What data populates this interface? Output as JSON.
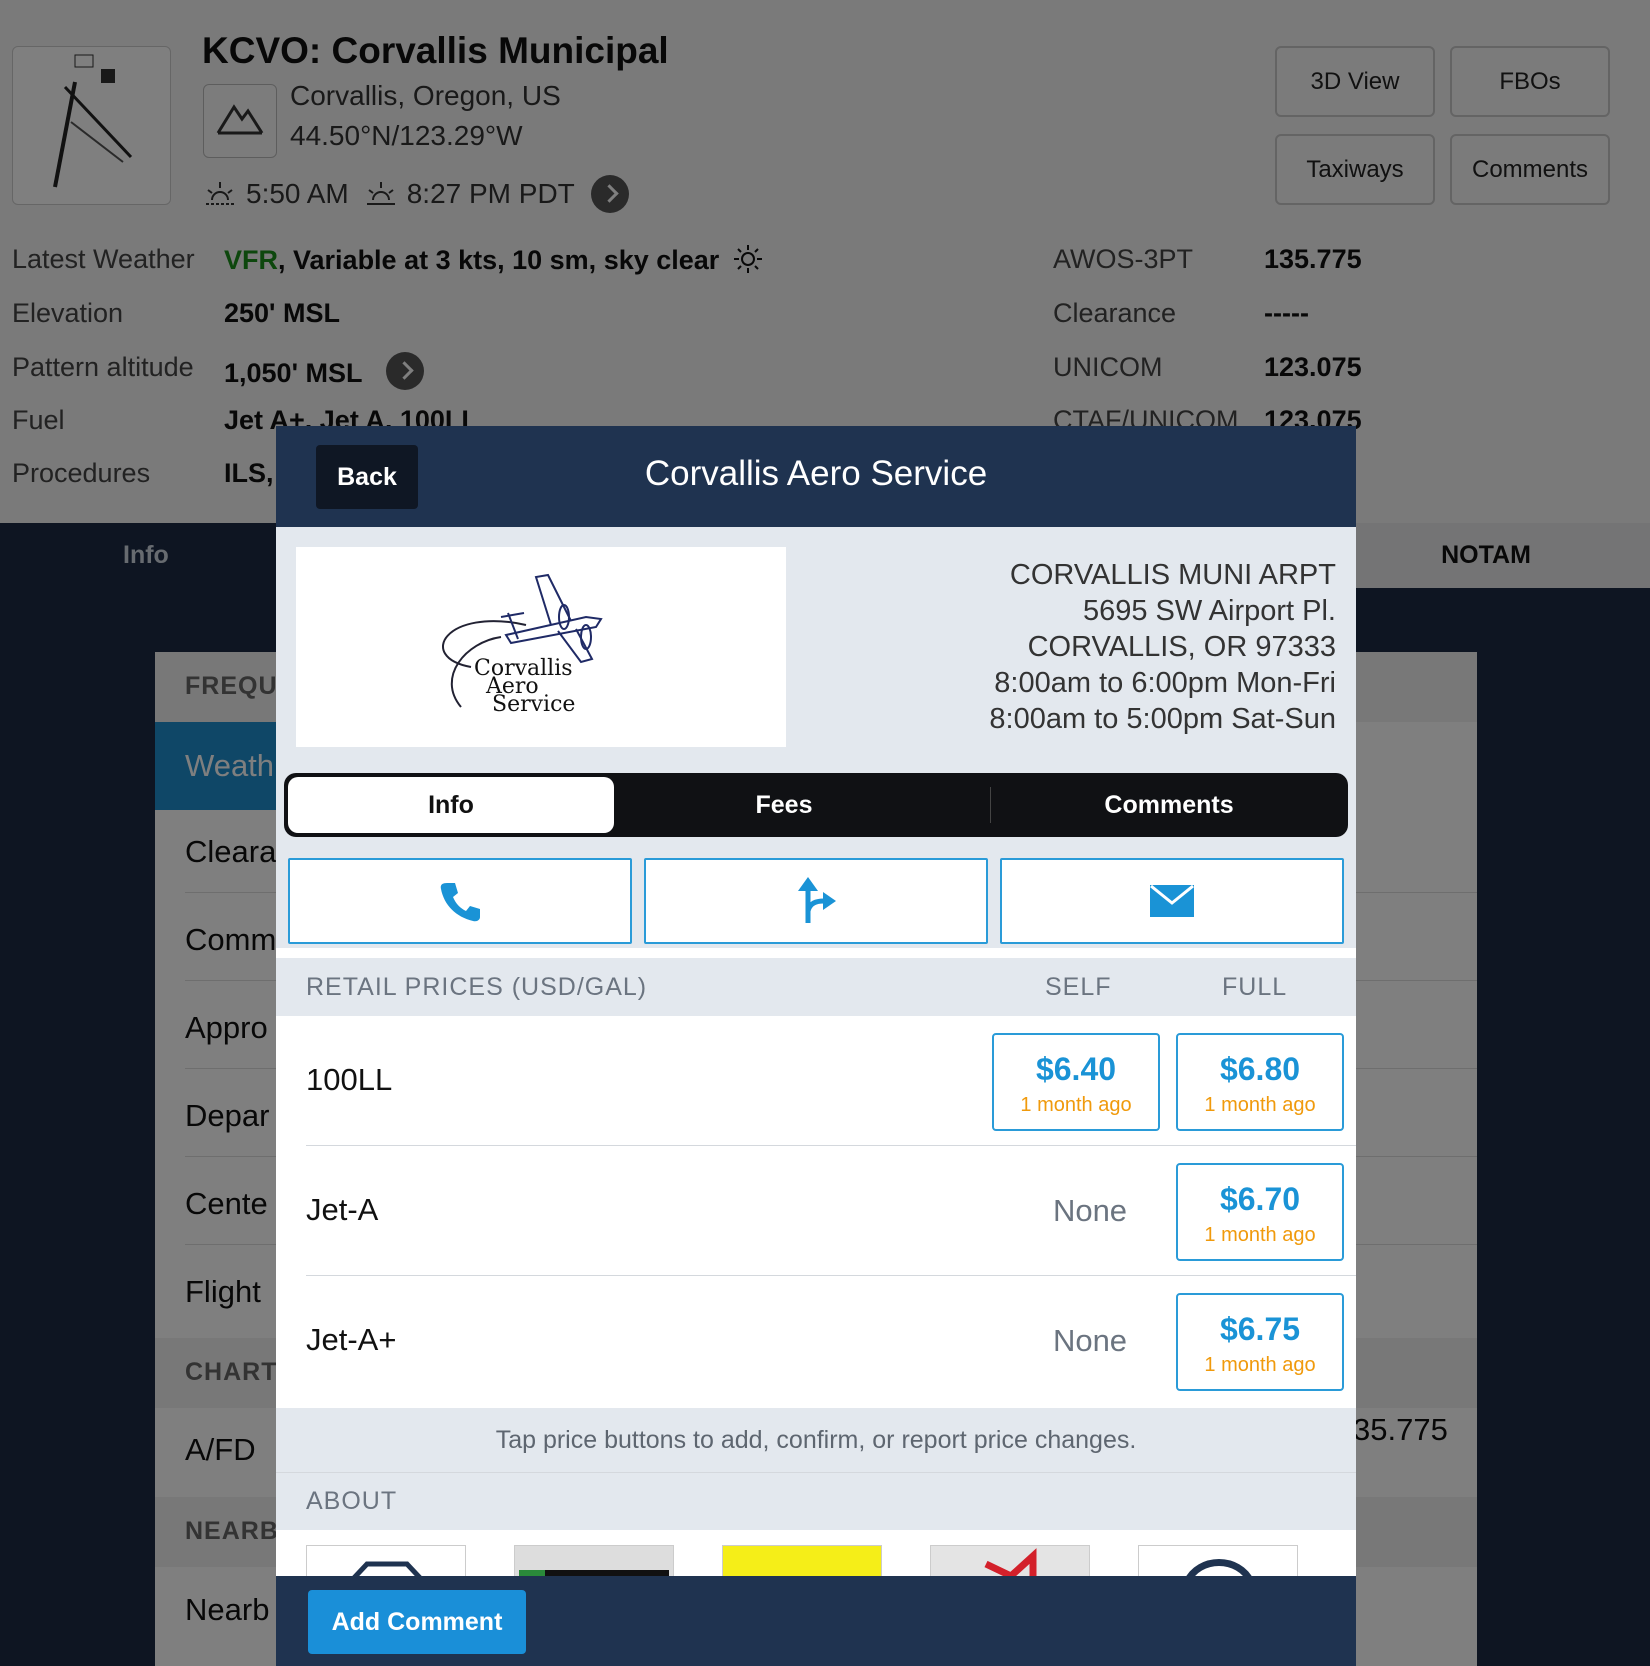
{
  "airport": {
    "title": "KCVO: Corvallis Municipal",
    "location": "Corvallis, Oregon, US",
    "coords": "44.50°N/123.29°W",
    "sunrise": "5:50 AM",
    "sunset": "8:27 PM PDT",
    "buttons": {
      "view3d": "3D View",
      "fbos": "FBOs",
      "taxiways": "Taxiways",
      "comments": "Comments"
    },
    "info": {
      "weather_label": "Latest Weather",
      "weather_cat": "VFR",
      "weather_text": ", Variable at 3 kts, 10 sm, sky clear",
      "elevation_label": "Elevation",
      "elevation_value": "250' MSL",
      "pattern_label": "Pattern altitude",
      "pattern_value": "1,050' MSL",
      "fuel_label": "Fuel",
      "fuel_value": "Jet A+, Jet A, 100LL",
      "procedures_label": "Procedures",
      "procedures_value": "ILS,"
    },
    "freqs": [
      {
        "label": "AWOS-3PT",
        "value": "135.775"
      },
      {
        "label": "Clearance",
        "value": "-----"
      },
      {
        "label": "UNICOM",
        "value": "123.075"
      },
      {
        "label": "CTAF/UNICOM",
        "value": "123.075"
      }
    ],
    "tabs": {
      "info": "Info",
      "notam": "NOTAM"
    },
    "side": {
      "sec_freq": "FREQU",
      "weather": "Weath",
      "rows": [
        "Cleara",
        "Comm",
        "Appro",
        "Depar",
        "Cente",
        "Flight"
      ],
      "sec_charts": "CHART",
      "afd": "A/FD",
      "sec_nearby": "NEARB",
      "nearby": "Nearb",
      "right_value": "35.775"
    }
  },
  "fbo": {
    "back": "Back",
    "title": "Corvallis Aero Service",
    "logo_text": [
      "Corvallis",
      "Aero",
      "Service"
    ],
    "address": [
      "CORVALLIS MUNI ARPT",
      "5695 SW Airport Pl.",
      "CORVALLIS, OR 97333",
      "8:00am to 6:00pm Mon-Fri",
      "8:00am to 5:00pm Sat-Sun"
    ],
    "tabs": {
      "info": "Info",
      "fees": "Fees",
      "comments": "Comments"
    },
    "actions": [
      "phone-icon",
      "directions-icon",
      "envelope-icon"
    ],
    "prices_header": "RETAIL PRICES (USD/GAL)",
    "self_header": "SELF",
    "full_header": "FULL",
    "fuels": [
      {
        "name": "100LL",
        "self": "$6.40",
        "self_age": "1 month ago",
        "full": "$6.80",
        "full_age": "1 month ago"
      },
      {
        "name": "Jet-A",
        "self_none": "None",
        "full": "$6.70",
        "full_age": "1 month ago"
      },
      {
        "name": "Jet-A+",
        "self_none": "None",
        "full": "$6.75",
        "full_age": "1 month ago"
      }
    ],
    "hint": "Tap price buttons to add, confirm, or report price changes.",
    "about_header": "ABOUT",
    "add_comment": "Add Comment"
  },
  "colors": {
    "accent": "#1a93d6",
    "age": "#f09a0c",
    "header": "#1f3350",
    "vfr": "#1a8f1a"
  }
}
